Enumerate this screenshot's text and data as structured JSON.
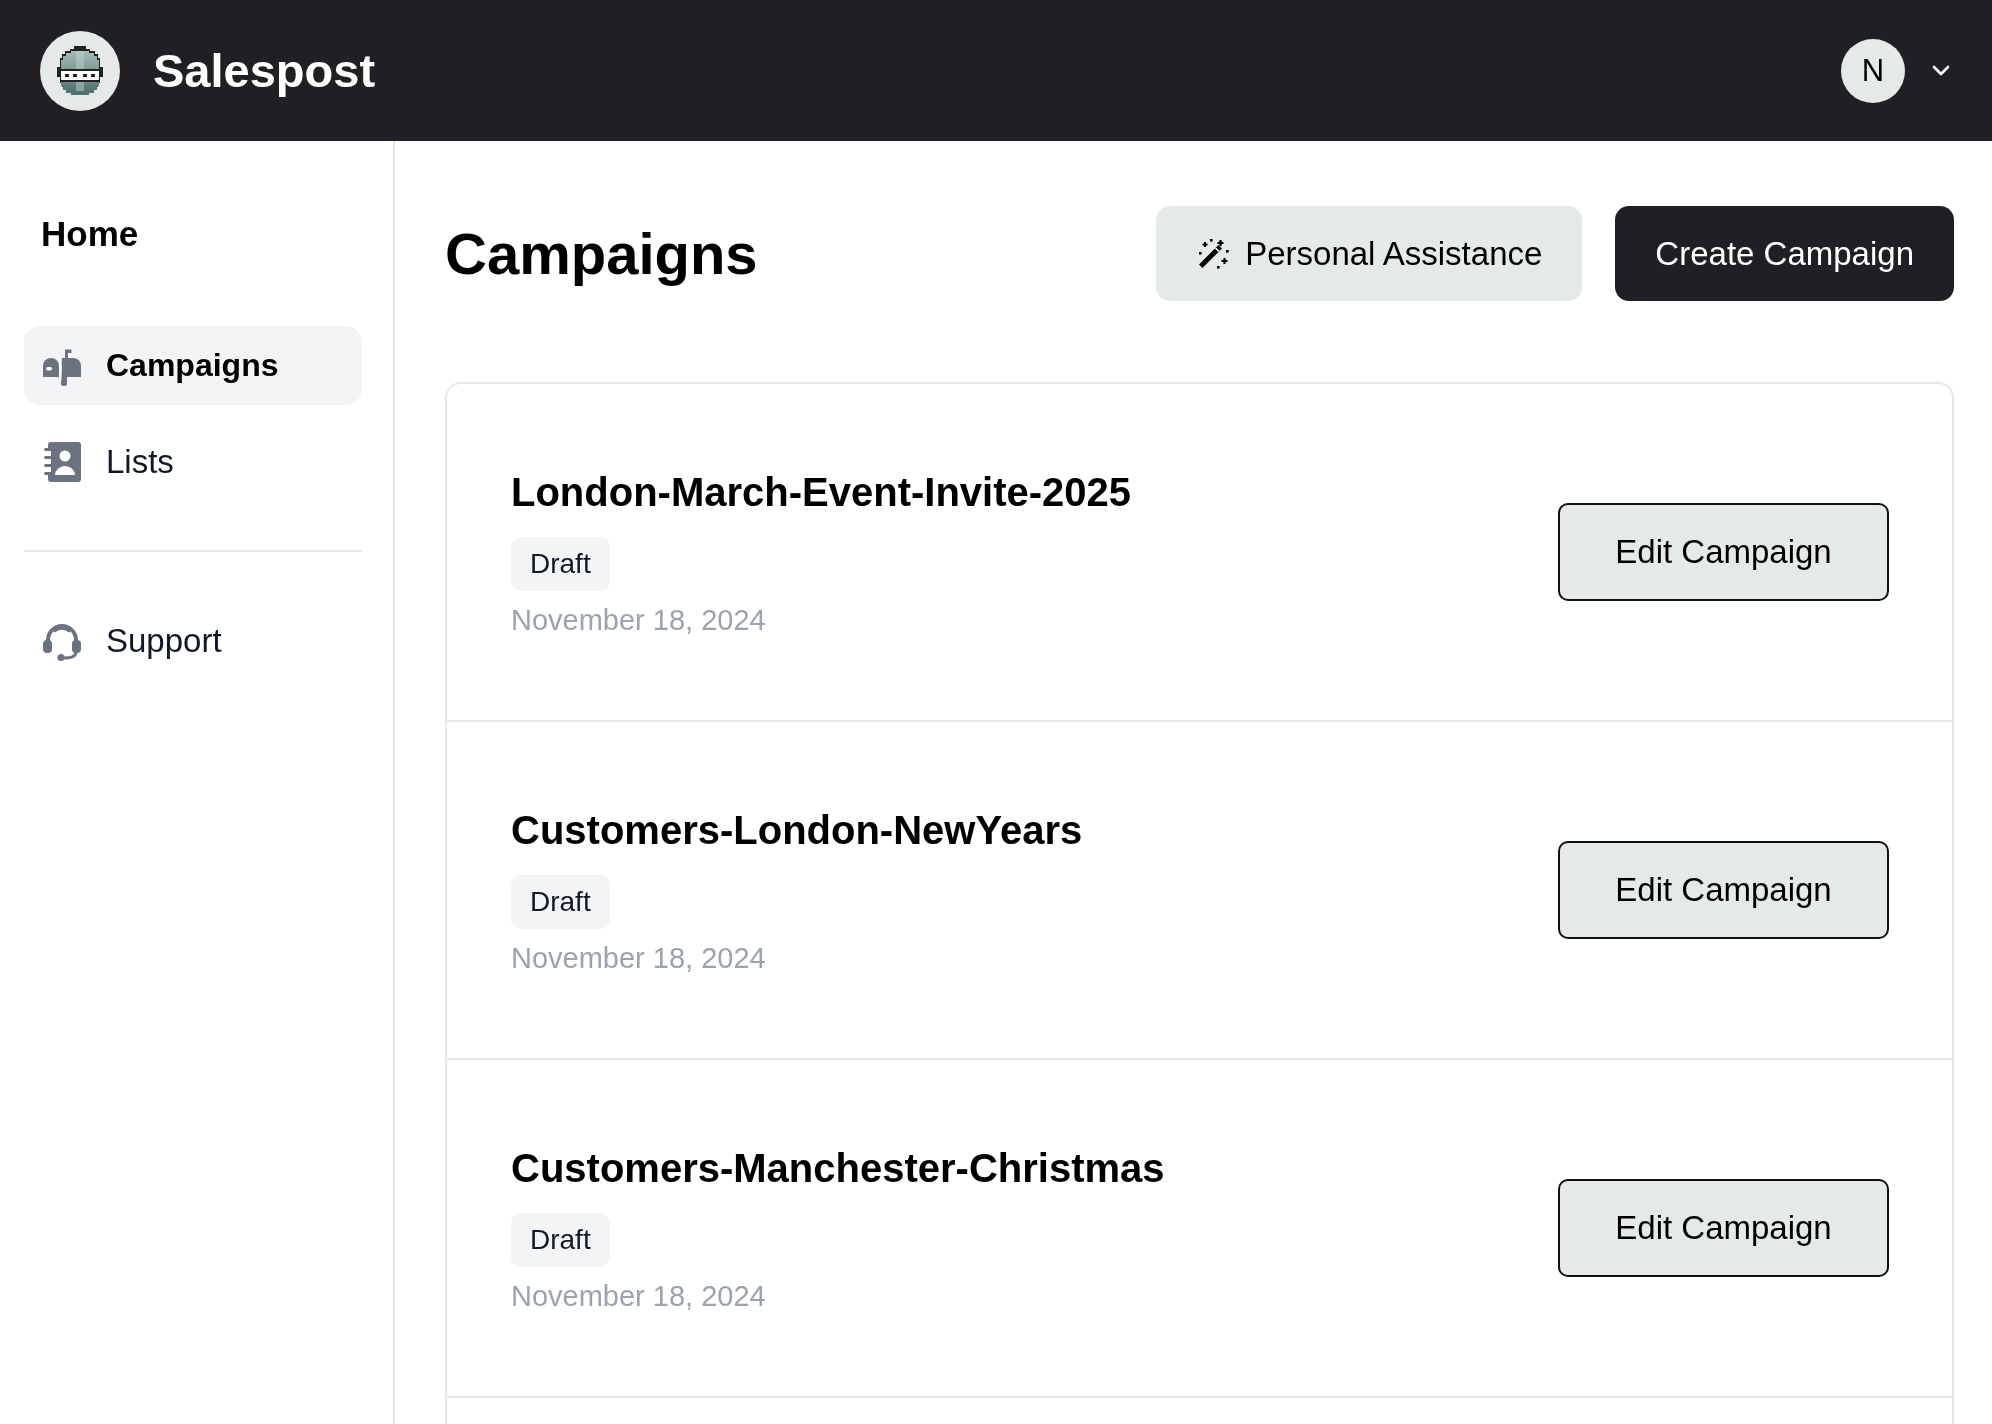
{
  "header": {
    "app_name": "Salespost",
    "user_initial": "N"
  },
  "sidebar": {
    "home": "Home",
    "items": [
      {
        "label": "Campaigns",
        "kind": "campaigns",
        "selected": true
      },
      {
        "label": "Lists",
        "kind": "lists",
        "selected": false
      }
    ],
    "footer_items": [
      {
        "label": "Support",
        "kind": "support",
        "selected": false
      }
    ]
  },
  "page": {
    "title": "Campaigns",
    "buttons": [
      {
        "label": "Personal Assistance",
        "kind": "assistant"
      },
      {
        "label": "Create Campaign",
        "kind": "create"
      }
    ]
  },
  "campaigns": [
    {
      "name": "London-March-Event-Invite-2025",
      "status": "Draft",
      "date": "November 18, 2024",
      "action": "Edit Campaign"
    },
    {
      "name": "Customers-London-NewYears",
      "status": "Draft",
      "date": "November 18, 2024",
      "action": "Edit Campaign"
    },
    {
      "name": "Customers-Manchester-Christmas",
      "status": "Draft",
      "date": "November 18, 2024",
      "action": "Edit Campaign"
    }
  ]
}
